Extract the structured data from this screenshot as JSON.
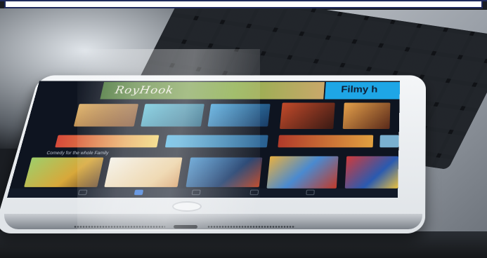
{
  "scene": {
    "description_name": "tablet-streaming-app-photo"
  },
  "screen_app": {
    "hero_left_title": "RoyHook",
    "hero_right_title": "Filmy h",
    "row_label": "Comedy for the whole Family"
  },
  "colors": {
    "frame": "#1f2a5c",
    "hero_blue": "#1ea6e6",
    "tab_active": "#2a6fd6"
  }
}
